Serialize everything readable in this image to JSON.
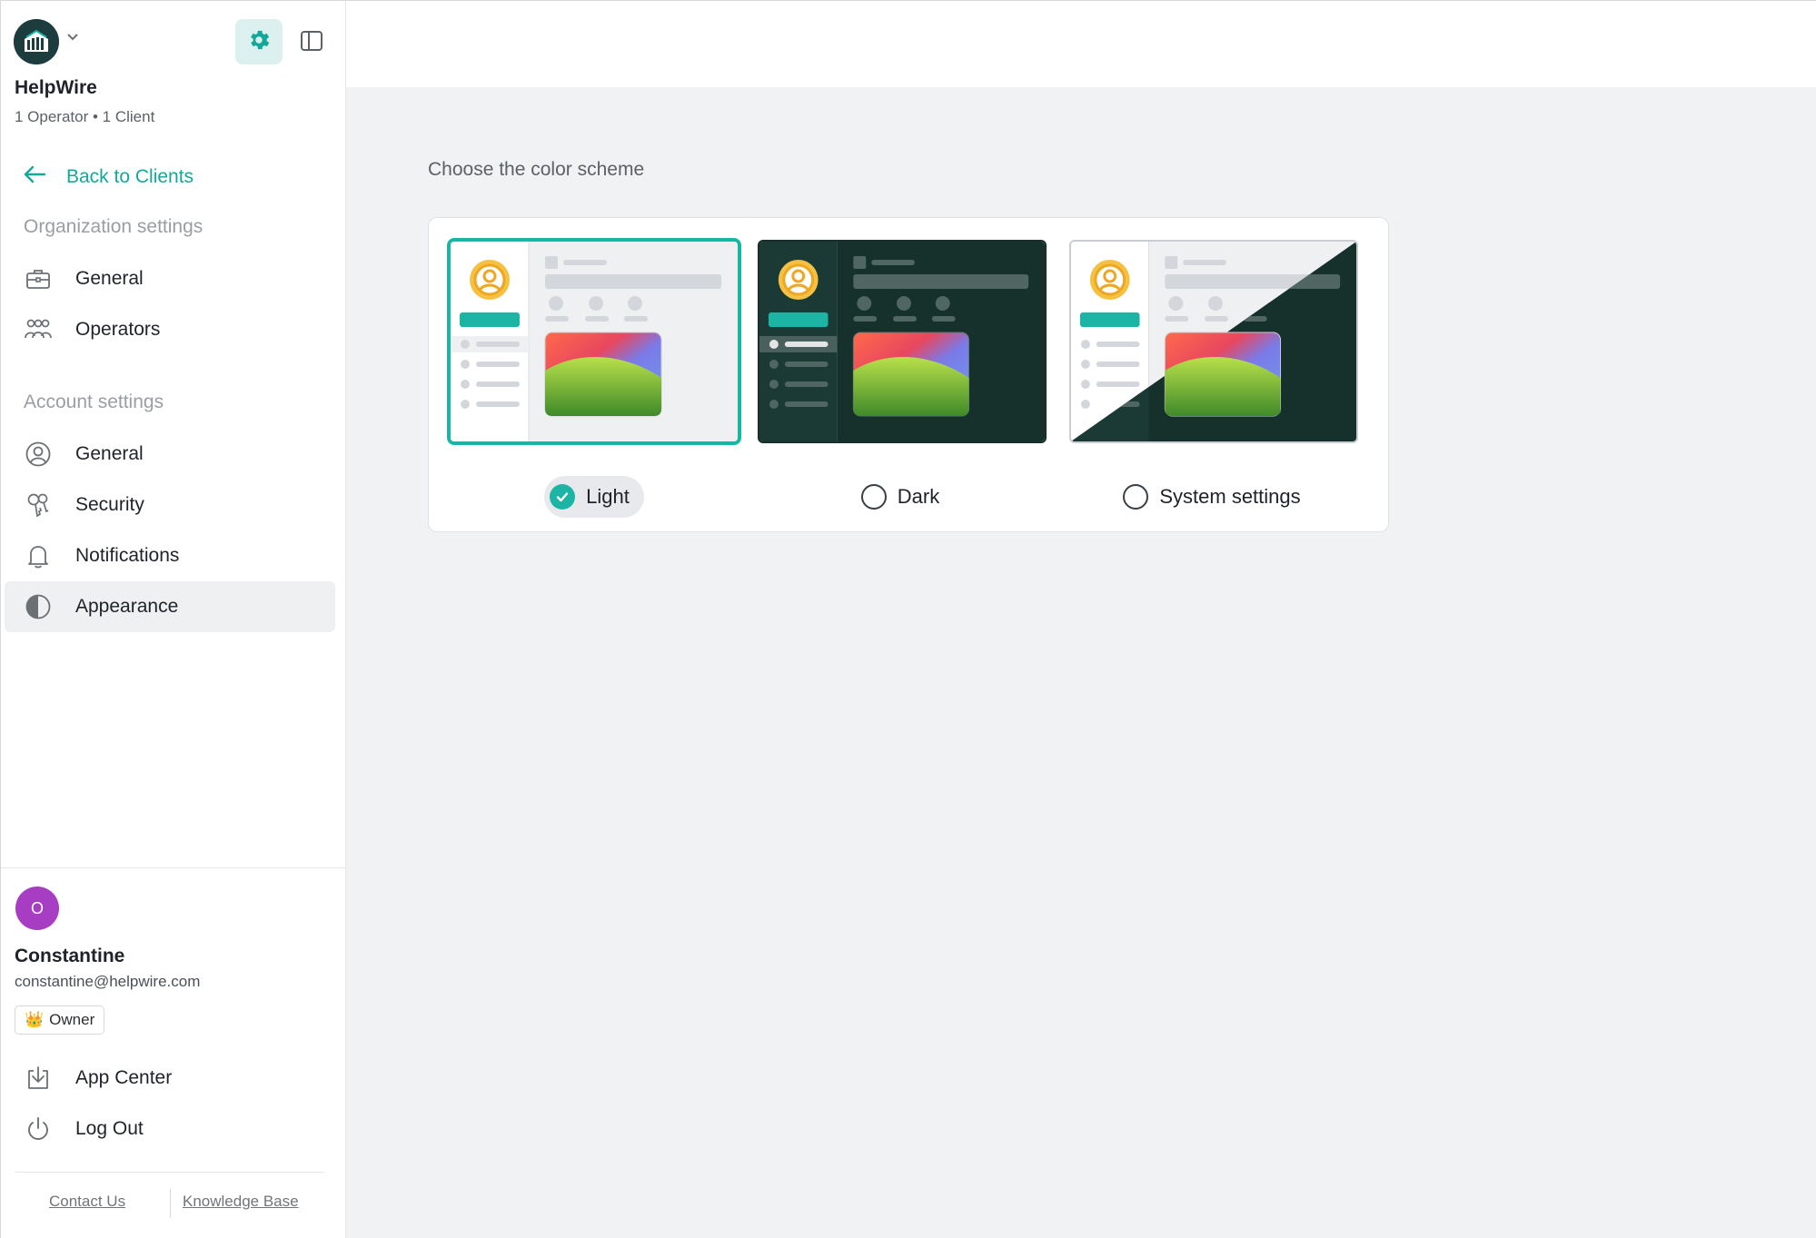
{
  "org": {
    "name": "HelpWire",
    "meta": "1 Operator • 1 Client"
  },
  "nav": {
    "back_label": "Back to Clients",
    "org_section": "Organization settings",
    "org_items": [
      {
        "label": "General",
        "icon": "briefcase-icon"
      },
      {
        "label": "Operators",
        "icon": "users-icon"
      }
    ],
    "account_section": "Account settings",
    "account_items": [
      {
        "label": "General",
        "icon": "user-circle-icon"
      },
      {
        "label": "Security",
        "icon": "keys-icon"
      },
      {
        "label": "Notifications",
        "icon": "bell-icon"
      },
      {
        "label": "Appearance",
        "icon": "contrast-icon",
        "active": true
      }
    ]
  },
  "user": {
    "initial": "O",
    "name": "Constantine",
    "email": "constantine@helpwire.com",
    "role_icon": "👑",
    "role": "Owner",
    "avatar_color": "#a63dc2"
  },
  "bottom_nav": [
    {
      "label": "App Center",
      "icon": "download-icon"
    },
    {
      "label": "Log Out",
      "icon": "power-icon"
    }
  ],
  "footer": {
    "contact": "Contact Us",
    "kb": "Knowledge Base"
  },
  "main": {
    "title": "Choose the color scheme",
    "options": [
      {
        "label": "Light",
        "selected": true
      },
      {
        "label": "Dark",
        "selected": false
      },
      {
        "label": "System settings",
        "selected": false
      }
    ]
  },
  "colors": {
    "accent": "#1cb5a5",
    "link": "#14a898",
    "dark_preview": "#16302c",
    "sidebar_active": "#eff0f2"
  }
}
